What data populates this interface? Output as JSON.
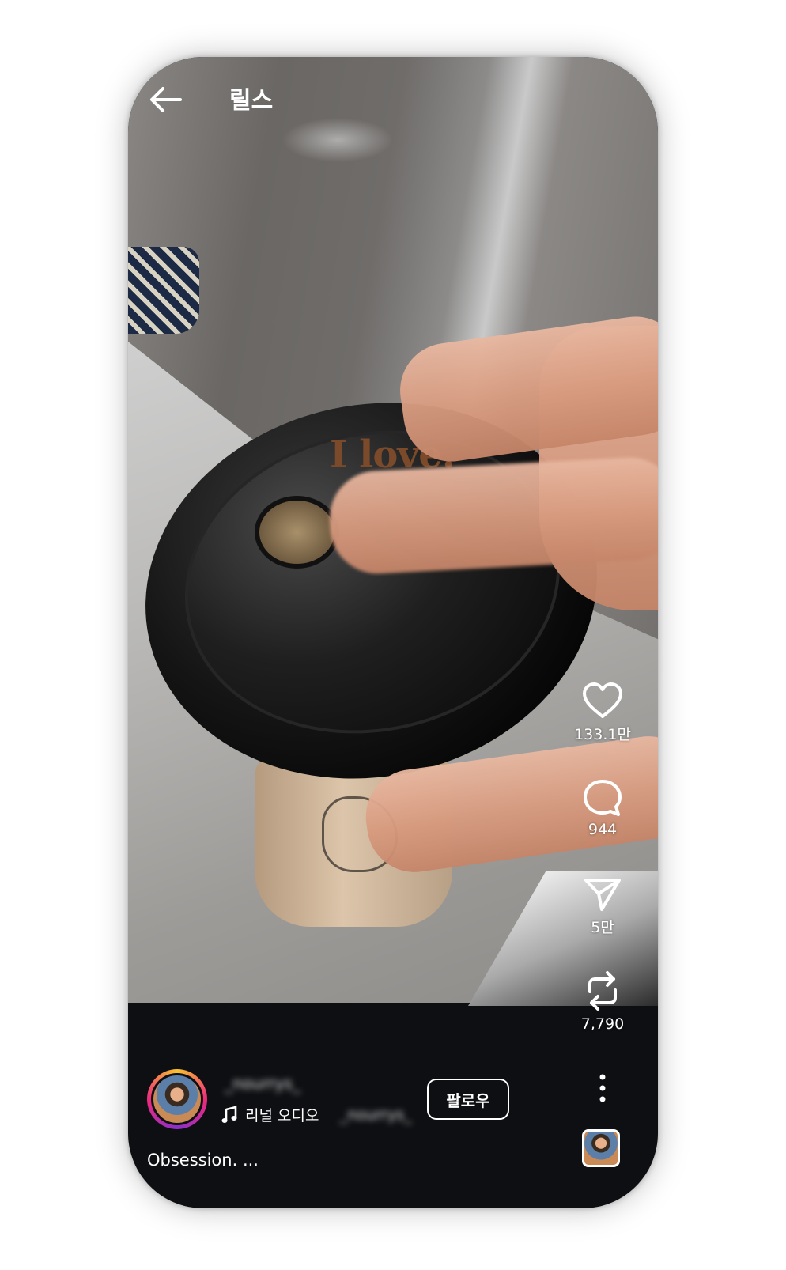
{
  "header": {
    "title": "릴스",
    "back_icon": "arrow-left-icon"
  },
  "video": {
    "overlay_text": "I love."
  },
  "actions": {
    "like": {
      "icon": "heart-icon",
      "count": "133.1만"
    },
    "comment": {
      "icon": "comment-bubble-icon",
      "count": "944"
    },
    "share": {
      "icon": "paper-plane-icon",
      "count": "5만"
    },
    "remix": {
      "icon": "repost-arrows-icon",
      "count": "7,790"
    },
    "more": {
      "icon": "more-vertical-icon"
    }
  },
  "post": {
    "username": "_nourrys_",
    "audio_label": "리널 오디오",
    "audio_owner": "_nourrys_",
    "follow_label": "팔로우",
    "caption": "Obsession. ..."
  },
  "colors": {
    "bottom_bar": "#0d0f12",
    "text": "#ffffff",
    "story_ring": [
      "#f9c22e",
      "#ee2a7b",
      "#8b2fc9"
    ]
  }
}
